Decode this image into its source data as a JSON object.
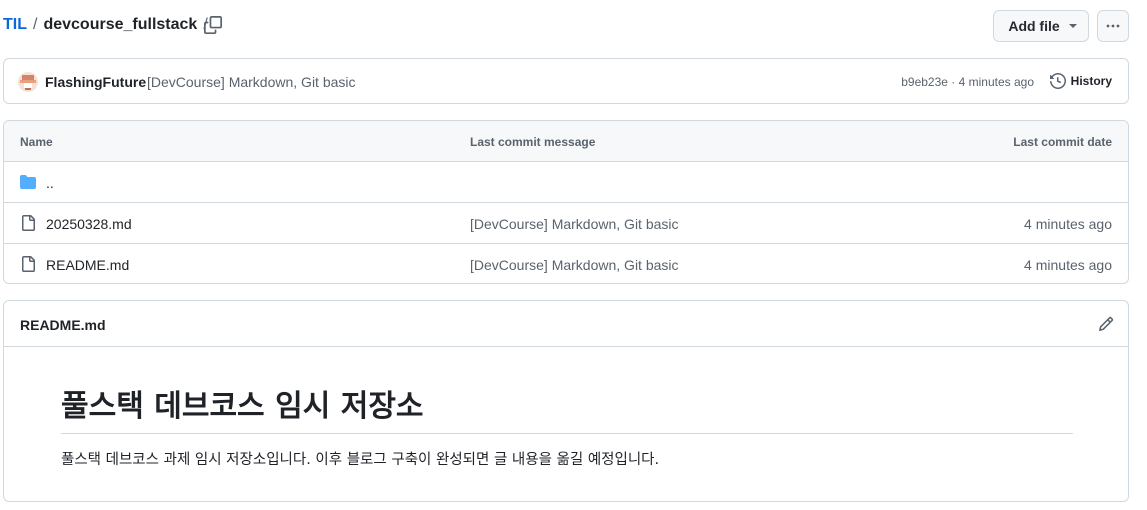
{
  "breadcrumb": {
    "repo": "TIL",
    "folder": "devcourse_fullstack",
    "sep": "/",
    "trail_sep": "/"
  },
  "toolbar": {
    "add_file_label": "Add file",
    "more_icon": "kebab-horizontal-icon"
  },
  "latest_commit": {
    "author": "FlashingFuture",
    "message": "[DevCourse] Markdown, Git basic",
    "meta": "b9eb23e · 4 minutes ago",
    "history_label": "History"
  },
  "files": {
    "headers": {
      "name": "Name",
      "message": "Last commit message",
      "date": "Last commit date"
    },
    "parent": "..",
    "rows": [
      {
        "name": "20250328.md",
        "message": "[DevCourse] Markdown, Git basic",
        "date": "4 minutes ago"
      },
      {
        "name": "README.md",
        "message": "[DevCourse] Markdown, Git basic",
        "date": "4 minutes ago"
      }
    ]
  },
  "readme": {
    "filename": "README.md",
    "heading": "풀스택 데브코스 임시 저장소",
    "paragraph": "풀스택 데브코스 과제 임시 저장소입니다. 이후 블로그 구축이 완성되면 글 내용을 옮길 예정입니다."
  },
  "colors": {
    "link": "#0969da",
    "folder": "#54aeff",
    "muted": "#59636e",
    "border": "#d1d9e0"
  }
}
